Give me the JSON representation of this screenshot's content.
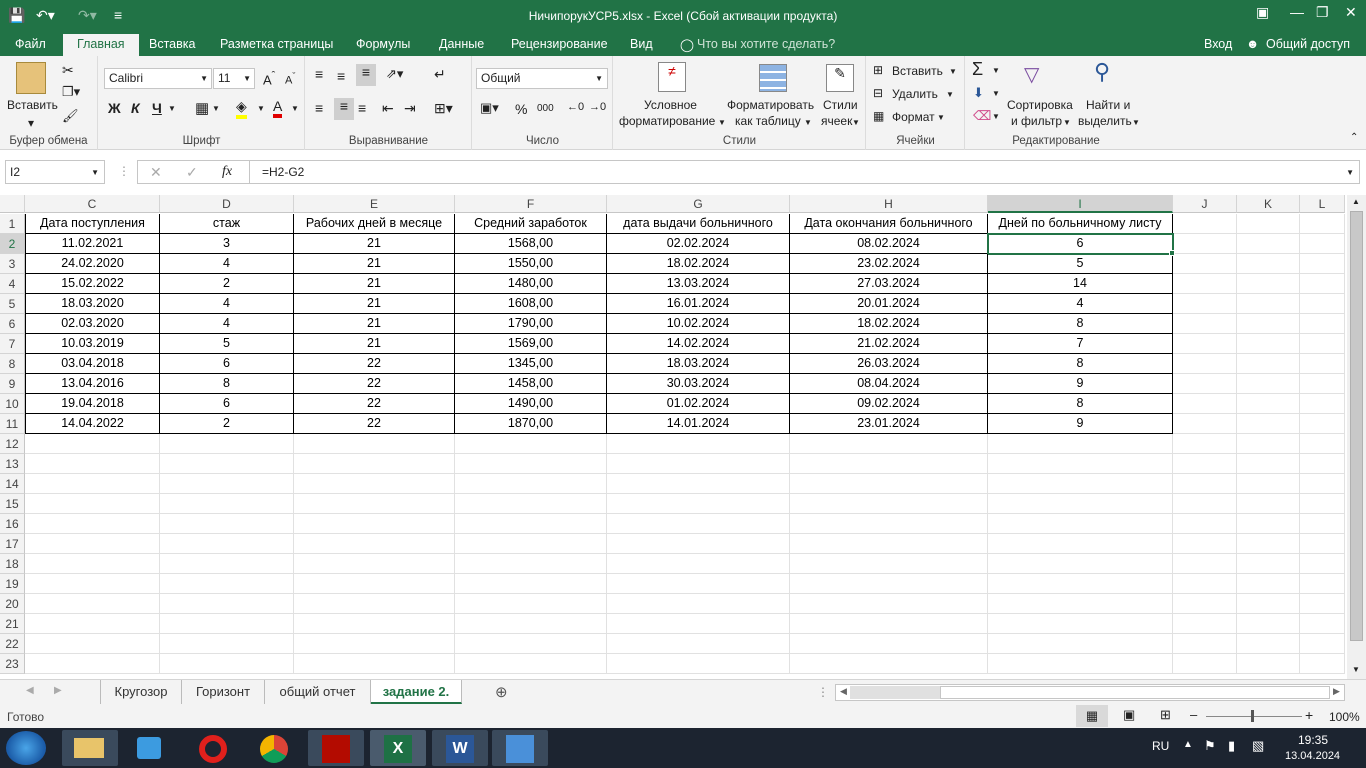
{
  "window": {
    "title": "НичипорукУСР5.xlsx - Excel (Сбой активации продукта)",
    "save_icon": "save-icon",
    "undo_icon": "undo-icon",
    "redo_icon": "redo-icon",
    "accent": "#217346"
  },
  "tabs": [
    "Файл",
    "Главная",
    "Вставка",
    "Разметка страницы",
    "Формулы",
    "Данные",
    "Рецензирование",
    "Вид"
  ],
  "tell_me": "Что вы хотите сделать?",
  "signin": "Вход",
  "share": "Общий доступ",
  "ribbon": {
    "clipboard": {
      "paste": "Вставить",
      "label": "Буфер обмена"
    },
    "font": {
      "name": "Calibri",
      "size": "11",
      "bold": "Ж",
      "italic": "К",
      "underline": "Ч",
      "label": "Шрифт"
    },
    "alignment": {
      "label": "Выравнивание"
    },
    "number": {
      "format": "Общий",
      "percent": "%",
      "thousands": "000",
      "label": "Число"
    },
    "styles": {
      "conditional_1": "Условное",
      "conditional_2": "форматирование",
      "table_1": "Форматировать",
      "table_2": "как таблицу",
      "cell_1": "Стили",
      "cell_2": "ячеек",
      "label": "Стили"
    },
    "cells": {
      "insert": "Вставить",
      "delete": "Удалить",
      "format": "Формат",
      "label": "Ячейки"
    },
    "editing": {
      "sort_1": "Сортировка",
      "sort_2": "и фильтр",
      "find_1": "Найти и",
      "find_2": "выделить",
      "label": "Редактирование"
    }
  },
  "formula_bar": {
    "name_box": "I2",
    "fx": "fx",
    "formula": "=H2-G2"
  },
  "columns": [
    "C",
    "D",
    "E",
    "F",
    "G",
    "H",
    "I",
    "J",
    "K",
    "L"
  ],
  "headers": [
    "Дата поступления",
    "стаж",
    "Рабочих дней в месяце",
    "Средний заработок",
    "дата выдачи больничного",
    "Дата окончания больничного",
    "Дней по больничному листу"
  ],
  "rows": [
    [
      "11.02.2021",
      "3",
      "21",
      "1568,00",
      "02.02.2024",
      "08.02.2024",
      "6"
    ],
    [
      "24.02.2020",
      "4",
      "21",
      "1550,00",
      "18.02.2024",
      "23.02.2024",
      "5"
    ],
    [
      "15.02.2022",
      "2",
      "21",
      "1480,00",
      "13.03.2024",
      "27.03.2024",
      "14"
    ],
    [
      "18.03.2020",
      "4",
      "21",
      "1608,00",
      "16.01.2024",
      "20.01.2024",
      "4"
    ],
    [
      "02.03.2020",
      "4",
      "21",
      "1790,00",
      "10.02.2024",
      "18.02.2024",
      "8"
    ],
    [
      "10.03.2019",
      "5",
      "21",
      "1569,00",
      "14.02.2024",
      "21.02.2024",
      "7"
    ],
    [
      "03.04.2018",
      "6",
      "22",
      "1345,00",
      "18.03.2024",
      "26.03.2024",
      "8"
    ],
    [
      "13.04.2016",
      "8",
      "22",
      "1458,00",
      "30.03.2024",
      "08.04.2024",
      "9"
    ],
    [
      "19.04.2018",
      "6",
      "22",
      "1490,00",
      "01.02.2024",
      "09.02.2024",
      "8"
    ],
    [
      "14.04.2022",
      "2",
      "22",
      "1870,00",
      "14.01.2024",
      "23.01.2024",
      "9"
    ]
  ],
  "row_numbers": [
    "1",
    "2",
    "3",
    "4",
    "5",
    "6",
    "7",
    "8",
    "9",
    "10",
    "11",
    "12",
    "13",
    "14",
    "15",
    "16",
    "17",
    "18",
    "19",
    "20",
    "21",
    "22",
    "23"
  ],
  "sheets": [
    "Кругозор",
    "Горизонт",
    "общий отчет",
    "задание 2."
  ],
  "active_sheet": "задание 2.",
  "status": {
    "ready": "Готово",
    "zoom": "100%"
  },
  "taskbar": {
    "lang": "RU",
    "time": "19:35",
    "date": "13.04.2024"
  }
}
